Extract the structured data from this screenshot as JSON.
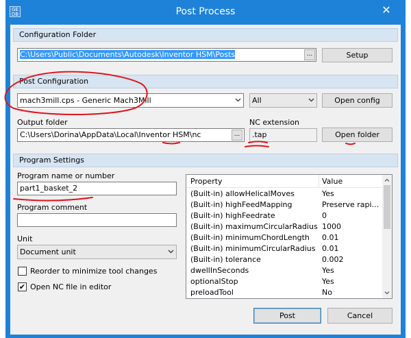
{
  "window": {
    "title": "Post Process",
    "app_icon_text": "GE\nDB",
    "close_glyph": "✕",
    "accent_color": "#1e82d8"
  },
  "config_folder": {
    "header": "Configuration Folder",
    "path": "C:\\Users\\Public\\Documents\\Autodesk\\Inventor HSM\\Posts",
    "browse_label": "...",
    "setup_label": "Setup"
  },
  "post_config": {
    "header": "Post Configuration",
    "selected": "mach3mill.cps - Generic Mach3Mill",
    "filter": "All",
    "open_config_label": "Open config",
    "output_folder_label": "Output folder",
    "output_folder": "C:\\Users\\Dorina\\AppData\\Local\\Inventor HSM\\nc",
    "browse_label": "...",
    "nc_extension_label": "NC extension",
    "nc_extension": ".tap",
    "open_folder_label": "Open folder"
  },
  "program_settings": {
    "header": "Program Settings",
    "name_label": "Program name or number",
    "name_value": "part1_basket_2",
    "comment_label": "Program comment",
    "comment_value": "",
    "unit_label": "Unit",
    "unit_value": "Document unit",
    "reorder_label": "Reorder to minimize tool changes",
    "reorder_checked": false,
    "open_nc_label": "Open NC file in editor",
    "open_nc_checked": true,
    "checkmark": "✔"
  },
  "properties": {
    "col_property": "Property",
    "col_value": "Value",
    "rows": [
      {
        "name": "(Built-in) allowHelicalMoves",
        "value": "Yes"
      },
      {
        "name": "(Built-in) highFeedMapping",
        "value": "Preserve rapi..."
      },
      {
        "name": "(Built-in) highFeedrate",
        "value": "0"
      },
      {
        "name": "(Built-in) maximumCircularRadius",
        "value": "1000"
      },
      {
        "name": "(Built-in) minimumChordLength",
        "value": "0.01"
      },
      {
        "name": "(Built-in) minimumCircularRadius",
        "value": "0.01"
      },
      {
        "name": "(Built-in) tolerance",
        "value": "0.002"
      },
      {
        "name": "dwellInSeconds",
        "value": "Yes"
      },
      {
        "name": "optionalStop",
        "value": "Yes"
      },
      {
        "name": "preloadTool",
        "value": "No"
      }
    ]
  },
  "footer": {
    "post_label": "Post",
    "cancel_label": "Cancel"
  },
  "annotation_color": "#e0141e"
}
